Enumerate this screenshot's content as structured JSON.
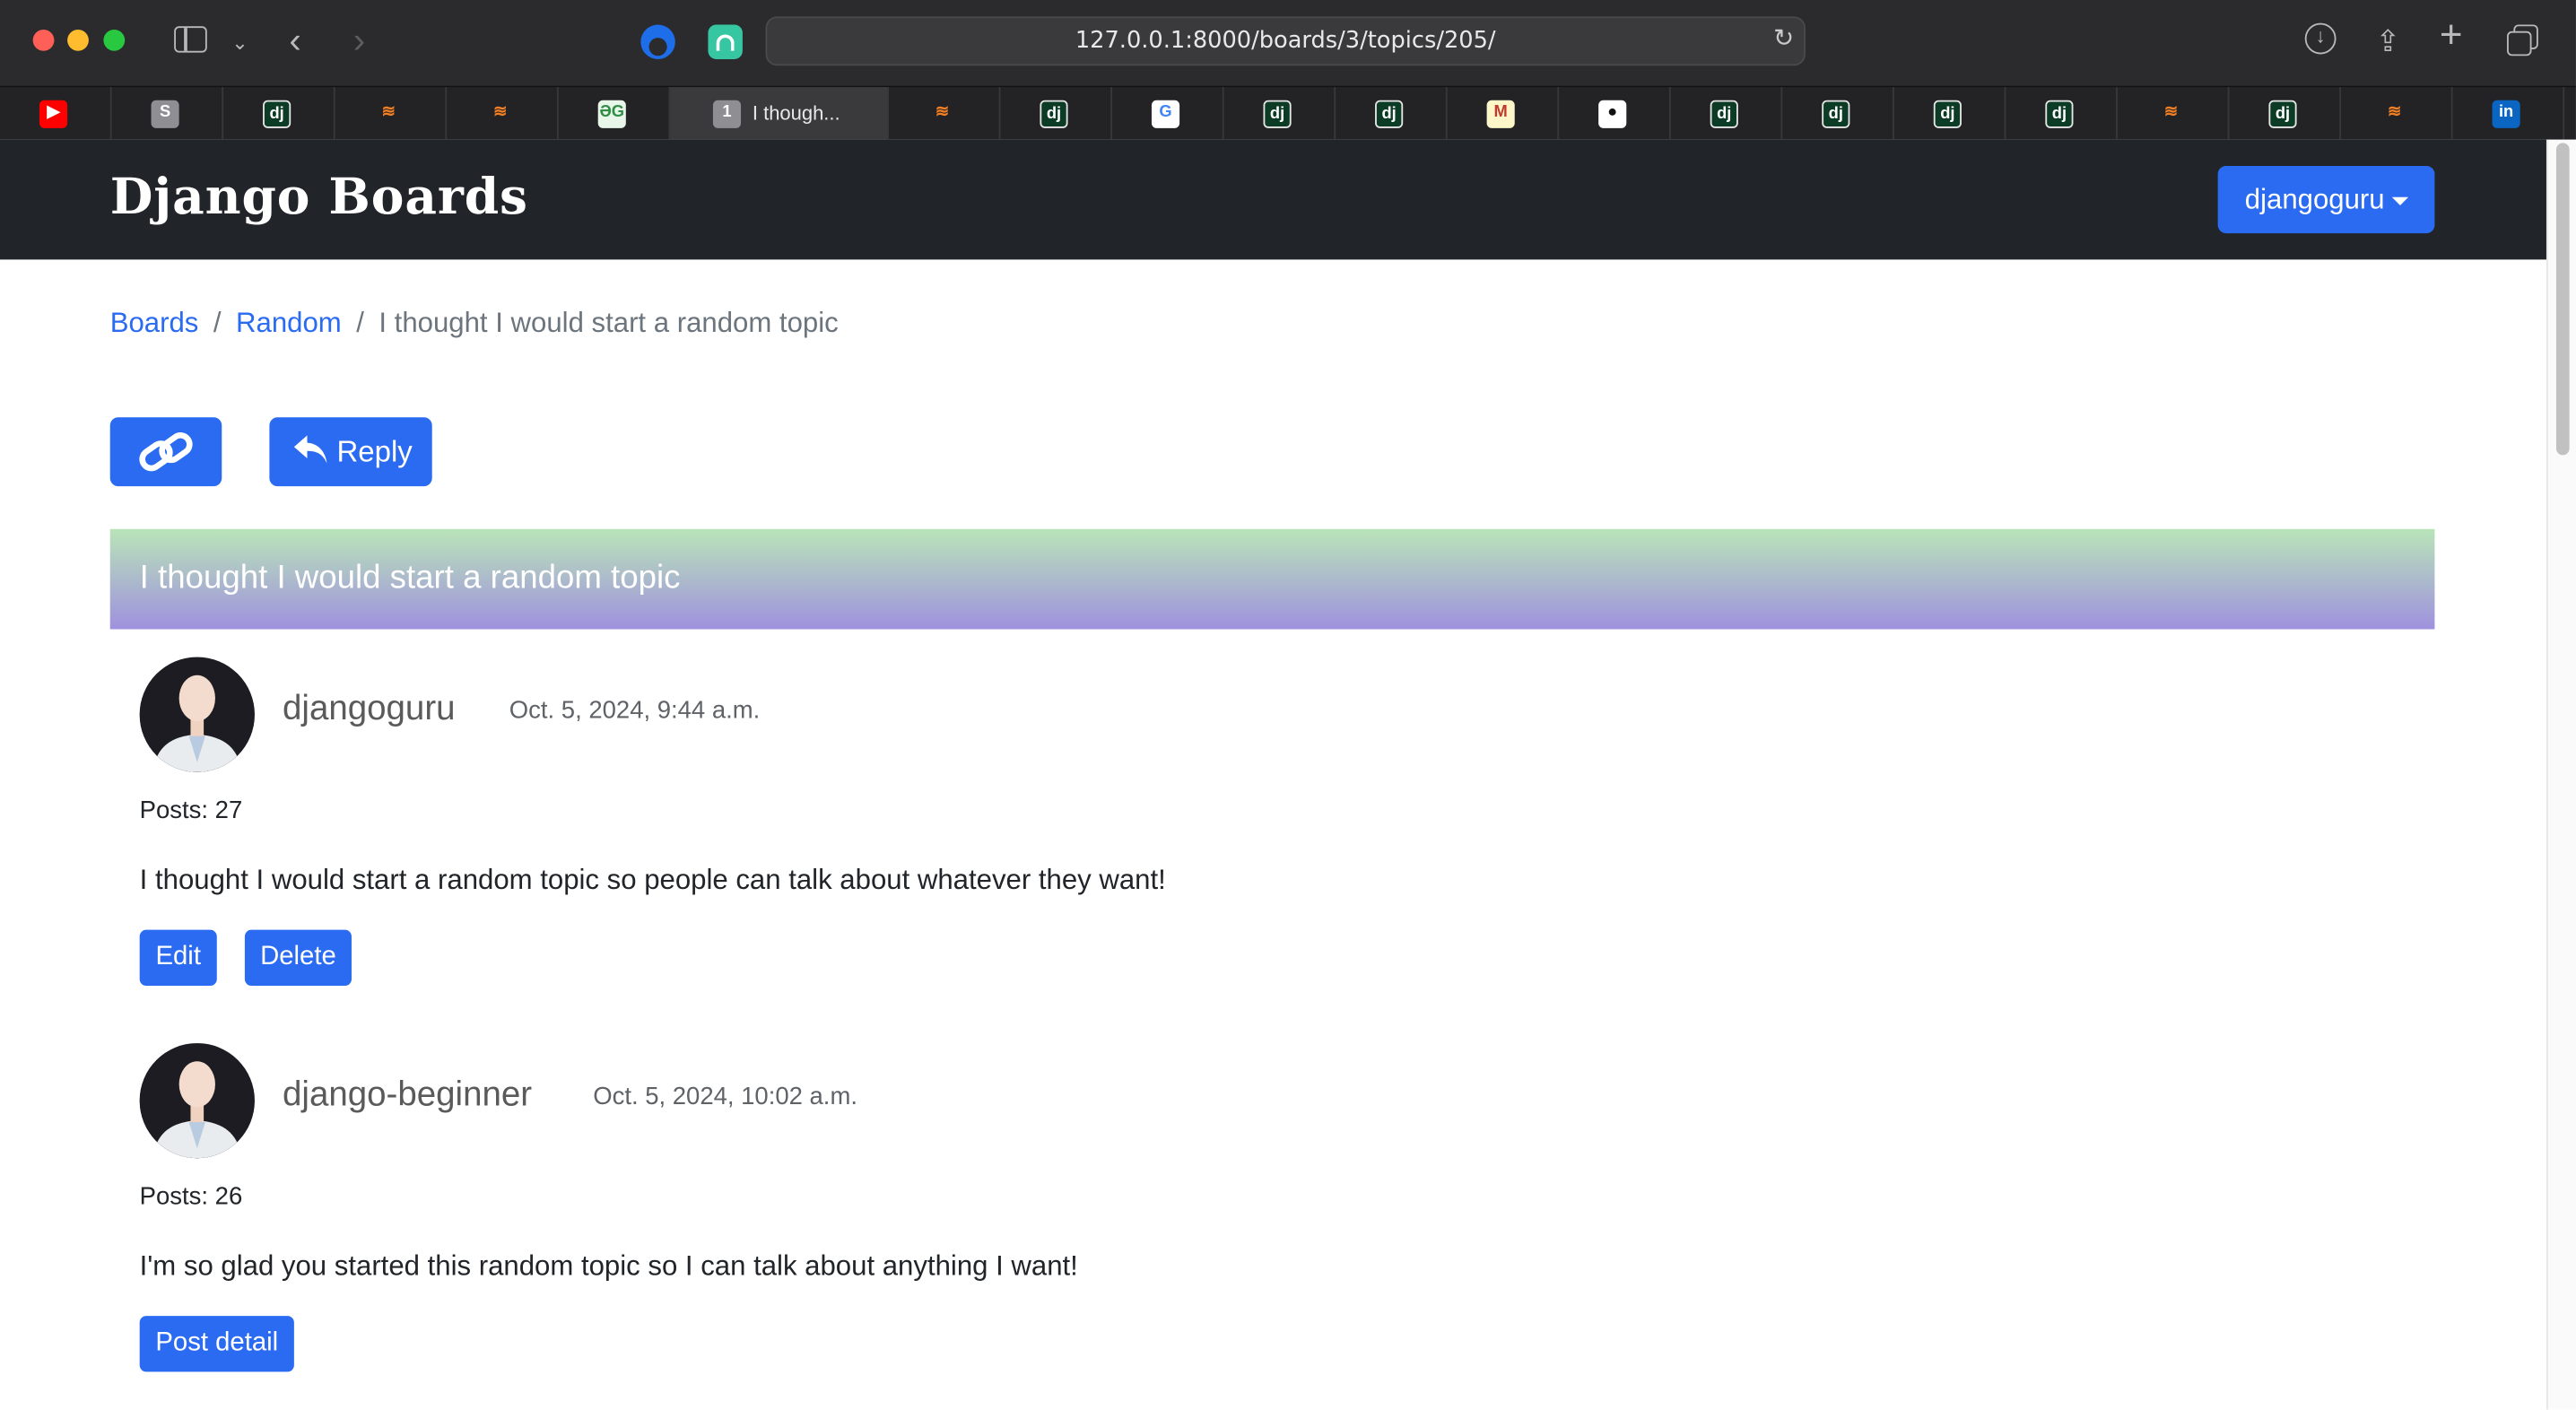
{
  "browser": {
    "url": "127.0.0.1:8000/boards/3/topics/205/",
    "active_tab_title": "I though...",
    "active_tab_badge": "1",
    "tabs": [
      {
        "icon": "youtube-icon",
        "glyph": "▶"
      },
      {
        "icon": "s-app-icon",
        "glyph": "S"
      },
      {
        "icon": "django-icon",
        "glyph": "dj"
      },
      {
        "icon": "stackoverflow-icon",
        "glyph": "≋"
      },
      {
        "icon": "stackoverflow-icon",
        "glyph": "≋"
      },
      {
        "icon": "geeksforgeeks-icon",
        "glyph": "ƏG"
      },
      {
        "icon": "active-tab",
        "glyph": "1"
      },
      {
        "icon": "stackoverflow-icon",
        "glyph": "≋"
      },
      {
        "icon": "django-icon",
        "glyph": "dj"
      },
      {
        "icon": "google-icon",
        "glyph": "G"
      },
      {
        "icon": "django-icon",
        "glyph": "dj"
      },
      {
        "icon": "django-icon",
        "glyph": "dj"
      },
      {
        "icon": "gmail-icon",
        "glyph": "M"
      },
      {
        "icon": "github-icon",
        "glyph": "●"
      },
      {
        "icon": "django-icon",
        "glyph": "dj"
      },
      {
        "icon": "django-icon",
        "glyph": "dj"
      },
      {
        "icon": "django-icon",
        "glyph": "dj"
      },
      {
        "icon": "django-icon",
        "glyph": "dj"
      },
      {
        "icon": "stackoverflow-icon",
        "glyph": "≋"
      },
      {
        "icon": "django-icon",
        "glyph": "dj"
      },
      {
        "icon": "stackoverflow-icon",
        "glyph": "≋"
      },
      {
        "icon": "linkedin-icon",
        "glyph": "in"
      }
    ]
  },
  "navbar": {
    "brand": "Django Boards",
    "user_menu": "djangoguru"
  },
  "breadcrumb": {
    "boards": "Boards",
    "separator": "/",
    "board": "Random",
    "current": "I thought I would start a random topic"
  },
  "actions": {
    "reply_label": "Reply"
  },
  "topic": {
    "title": "I thought I would start a random topic"
  },
  "posts": [
    {
      "author": "djangoguru",
      "date": "Oct. 5, 2024, 9:44 a.m.",
      "posts_count": "Posts: 27",
      "message": "I thought I would start a random topic so people can talk about whatever they want!",
      "buttons": [
        "Edit",
        "Delete"
      ]
    },
    {
      "author": "django-beginner",
      "date": "Oct. 5, 2024, 10:02 a.m.",
      "posts_count": "Posts: 26",
      "message": "I'm so glad you started this random topic so I can talk about anything I want!",
      "buttons": [
        "Post detail"
      ]
    }
  ],
  "colors": {
    "primary": "#2a6bf2",
    "navbar": "#212529",
    "header_gradient_top": "#b9e4b8",
    "header_gradient_bottom": "#9f91de"
  }
}
